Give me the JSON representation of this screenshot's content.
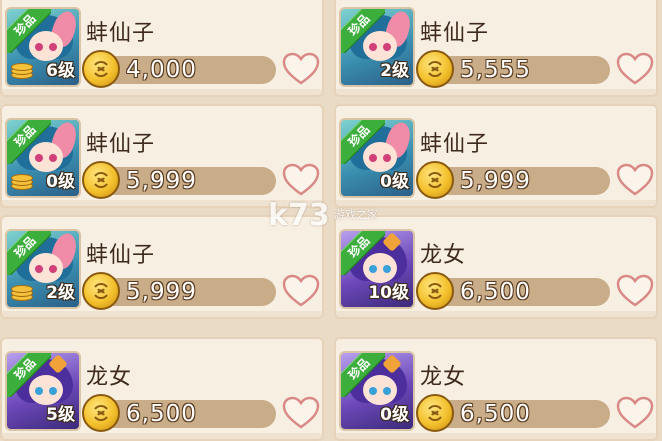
{
  "badge_label": "珍品",
  "colors": {
    "card_bg": "#f8efe3",
    "price_bar": "#c9ac88",
    "badge_green": "#3cae3c",
    "heart_outline": "#d98a86"
  },
  "watermark": {
    "main": "k73",
    "sub": "游戏之家"
  },
  "items": [
    {
      "name": "蚌仙子",
      "level": "6级",
      "price": "4,000",
      "character": "mussel-fairy"
    },
    {
      "name": "蚌仙子",
      "level": "2级",
      "price": "5,555",
      "character": "mussel-fairy"
    },
    {
      "name": "蚌仙子",
      "level": "0级",
      "price": "5,999",
      "character": "mussel-fairy"
    },
    {
      "name": "蚌仙子",
      "level": "0级",
      "price": "5,999",
      "character": "mussel-fairy"
    },
    {
      "name": "蚌仙子",
      "level": "2级",
      "price": "5,999",
      "character": "mussel-fairy"
    },
    {
      "name": "龙女",
      "level": "10级",
      "price": "6,500",
      "character": "dragon-maiden"
    },
    {
      "name": "龙女",
      "level": "5级",
      "price": "6,500",
      "character": "dragon-maiden"
    },
    {
      "name": "龙女",
      "level": "0级",
      "price": "6,500",
      "character": "dragon-maiden"
    }
  ]
}
